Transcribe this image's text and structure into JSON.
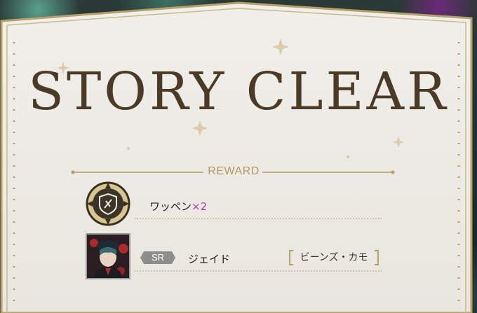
{
  "title": "STORY CLEAR",
  "reward_label": "REWARD",
  "rewards": [
    {
      "icon": "patch-emblem-icon",
      "name": "ワッペン",
      "quantity": "×2"
    },
    {
      "icon": "character-portrait",
      "rarity": "SR",
      "name": "ジェイド",
      "outfit": "ビーンズ・カモ"
    }
  ],
  "colors": {
    "panel": "#eeece6",
    "frame_gold": "#b5a06a",
    "title": "#4a3a26",
    "quantity": "#b43ab4",
    "rarity_badge": "#8d8d8d"
  }
}
